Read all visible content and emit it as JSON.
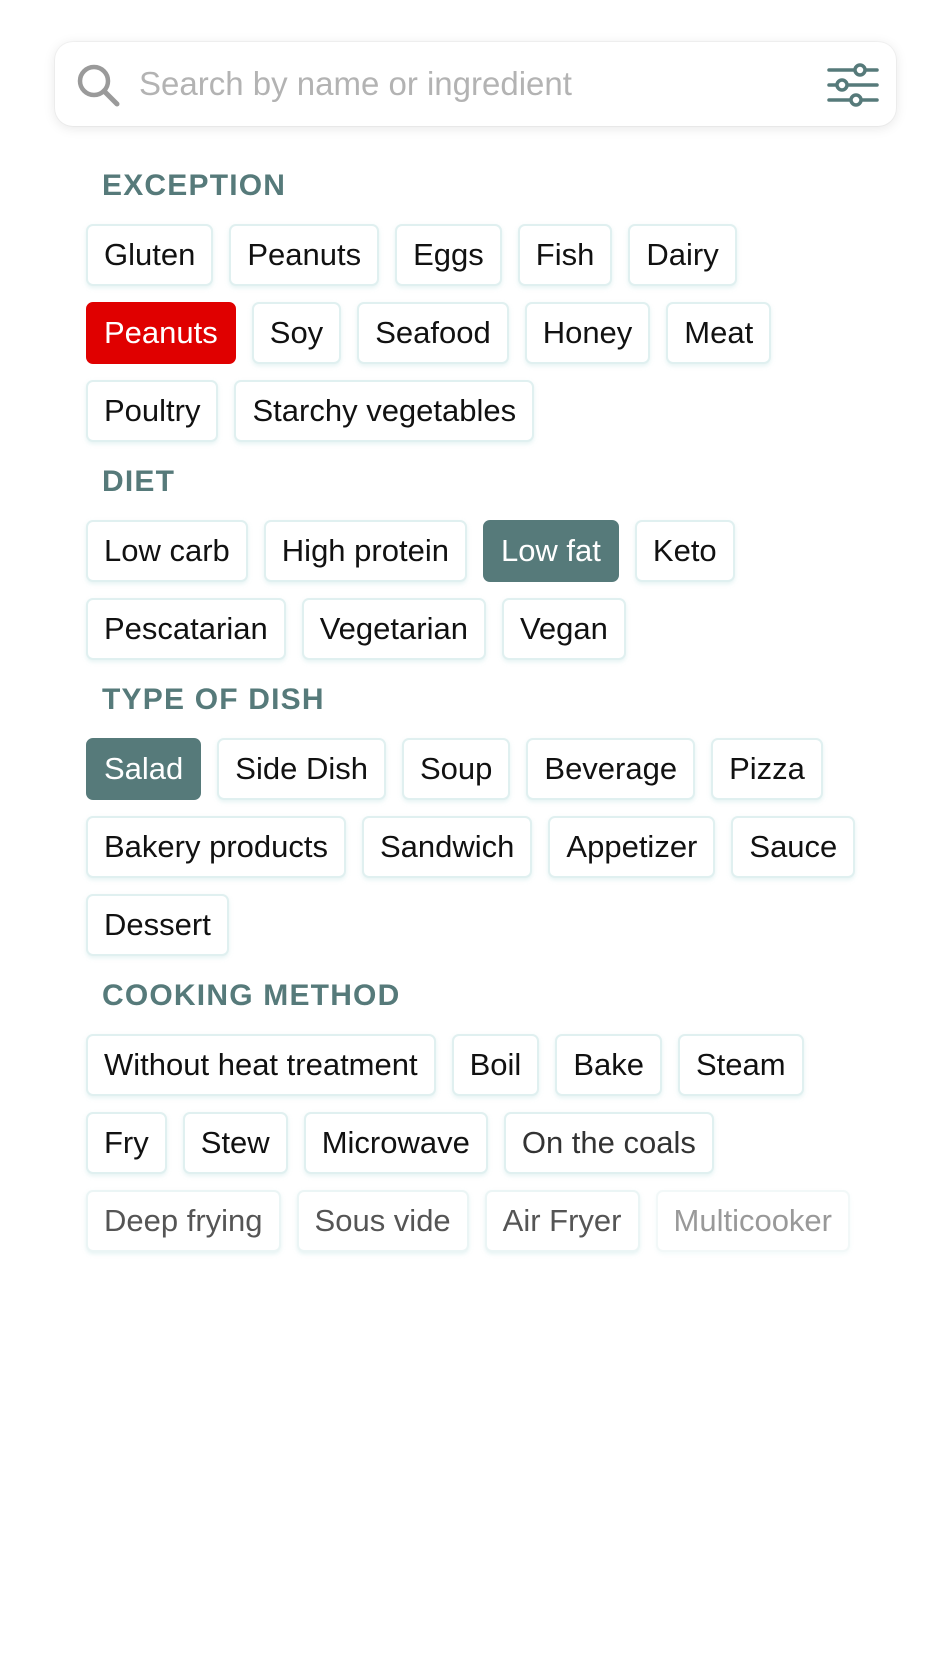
{
  "search": {
    "placeholder": "Search by name or ingredient",
    "value": "",
    "icon": "search-icon",
    "filter_icon": "sliders-icon"
  },
  "colors": {
    "accent": "#567a7a",
    "danger": "#e00000",
    "chip_border": "#e0f0f0"
  },
  "sections": [
    {
      "key": "exception",
      "title": "EXCEPTION",
      "chips": [
        {
          "label": "Gluten",
          "state": "default"
        },
        {
          "label": "Peanuts",
          "state": "default"
        },
        {
          "label": "Eggs",
          "state": "default"
        },
        {
          "label": "Fish",
          "state": "default"
        },
        {
          "label": "Dairy",
          "state": "default"
        },
        {
          "label": "Peanuts",
          "state": "selected-red"
        },
        {
          "label": "Soy",
          "state": "default"
        },
        {
          "label": "Seafood",
          "state": "default"
        },
        {
          "label": "Honey",
          "state": "default"
        },
        {
          "label": "Meat",
          "state": "default"
        },
        {
          "label": "Poultry",
          "state": "default"
        },
        {
          "label": "Starchy vegetables",
          "state": "default"
        }
      ]
    },
    {
      "key": "diet",
      "title": "DIET",
      "chips": [
        {
          "label": "Low carb",
          "state": "default"
        },
        {
          "label": "High protein",
          "state": "default"
        },
        {
          "label": "Low fat",
          "state": "selected"
        },
        {
          "label": "Keto",
          "state": "default"
        },
        {
          "label": "Pescatarian",
          "state": "default"
        },
        {
          "label": "Vegetarian",
          "state": "default"
        },
        {
          "label": "Vegan",
          "state": "default"
        }
      ]
    },
    {
      "key": "type-of-dish",
      "title": "TYPE OF DISH",
      "chips": [
        {
          "label": "Salad",
          "state": "selected"
        },
        {
          "label": "Side Dish",
          "state": "default"
        },
        {
          "label": "Soup",
          "state": "default"
        },
        {
          "label": "Beverage",
          "state": "default"
        },
        {
          "label": "Pizza",
          "state": "default"
        },
        {
          "label": "Bakery products",
          "state": "default"
        },
        {
          "label": "Sandwich",
          "state": "default"
        },
        {
          "label": "Appetizer",
          "state": "default"
        },
        {
          "label": "Sauce",
          "state": "default"
        },
        {
          "label": "Dessert",
          "state": "default"
        }
      ]
    },
    {
      "key": "cooking-method",
      "title": "COOKING METHOD",
      "chips": [
        {
          "label": "Without heat treatment",
          "state": "default"
        },
        {
          "label": "Boil",
          "state": "default"
        },
        {
          "label": "Bake",
          "state": "default"
        },
        {
          "label": "Steam",
          "state": "default"
        },
        {
          "label": "Fry",
          "state": "default"
        },
        {
          "label": "Stew",
          "state": "default"
        },
        {
          "label": "Microwave",
          "state": "default"
        },
        {
          "label": "On the coals",
          "state": "fade-1"
        },
        {
          "label": "Deep frying",
          "state": "fade-2"
        },
        {
          "label": "Sous vide",
          "state": "fade-2"
        },
        {
          "label": "Air Fryer",
          "state": "fade-2"
        },
        {
          "label": "Multicooker",
          "state": "fade-3"
        }
      ]
    }
  ]
}
